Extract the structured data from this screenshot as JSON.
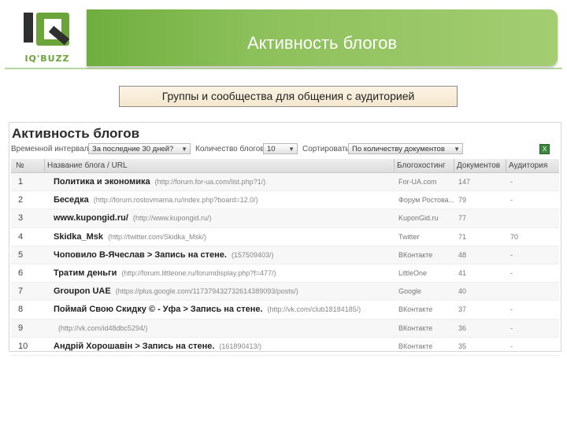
{
  "slide": {
    "logo": {
      "mark": "IQ",
      "caption": "IQ'BUZZ"
    },
    "title": "Активность блогов",
    "subtitle": "Группы и сообщества для общения с аудиторией",
    "colors": {
      "accent": "#6fae3e",
      "accent_light": "#a4cd72",
      "logo_dark": "#2f2f2f"
    }
  },
  "screenshot": {
    "heading": "Активность блогов",
    "controls": {
      "interval_label": "Временной интервал",
      "interval_value": "За последние 30 дней?",
      "count_label": "Количество блогов",
      "count_value": "10",
      "sort_label": "Сортировать",
      "sort_value": "По количеству документов",
      "export_icon": "excel-icon"
    },
    "columns": [
      "№",
      "Название блога / URL",
      "Блогохостинг",
      "Документов",
      "Аудитория"
    ],
    "rows": [
      {
        "num": "1",
        "name": "Политика и экономика",
        "url": "(http://forum.for-ua.com/list.php?1/)",
        "host": "For-UA.com",
        "docs": "147",
        "aud": "-"
      },
      {
        "num": "2",
        "name": "Беседка",
        "url": "(http://forum.rostovmama.ru/index.php?board=12.0/)",
        "host": "Форум Ростова...",
        "docs": "79",
        "aud": "-"
      },
      {
        "num": "3",
        "name": "www.kupongid.ru/",
        "url": "(http://www.kupongid.ru/)",
        "host": "KuponGid.ru",
        "docs": "77",
        "aud": ""
      },
      {
        "num": "4",
        "name": "Skidka_Msk",
        "url": "(http://twitter.com/Skidka_Msk/)",
        "host": "Twitter",
        "docs": "71",
        "aud": "70"
      },
      {
        "num": "5",
        "name": "Чоповило В-Ячеслав > Запись на стене.",
        "url": "(157509403/)",
        "host": "ВКонтакте",
        "docs": "48",
        "aud": "-"
      },
      {
        "num": "6",
        "name": "Тратим деньги",
        "url": "(http://forum.littleone.ru/forumdisplay.php?f=477/)",
        "host": "LittleOne",
        "docs": "41",
        "aud": "-"
      },
      {
        "num": "7",
        "name": "Groupon UAE",
        "url": "(https://plus.google.com/117379432732614389093/posts/)",
        "host": "Google",
        "docs": "40",
        "aud": ""
      },
      {
        "num": "8",
        "name": "Поймай Свою Скидку © - Уфа > Запись на стене.",
        "url": "(http://vk.com/club18184185/)",
        "host": "ВКонтакте",
        "docs": "37",
        "aud": "-"
      },
      {
        "num": "9",
        "name": "",
        "url": "(http://vk.com/id48dbc5294/)",
        "host": "ВКонтакте",
        "docs": "36",
        "aud": "-"
      },
      {
        "num": "10",
        "name": "Андрій Хорошавін > Запись на стене.",
        "url": "(161890413/)",
        "host": "ВКонтакте",
        "docs": "35",
        "aud": "-"
      }
    ]
  }
}
